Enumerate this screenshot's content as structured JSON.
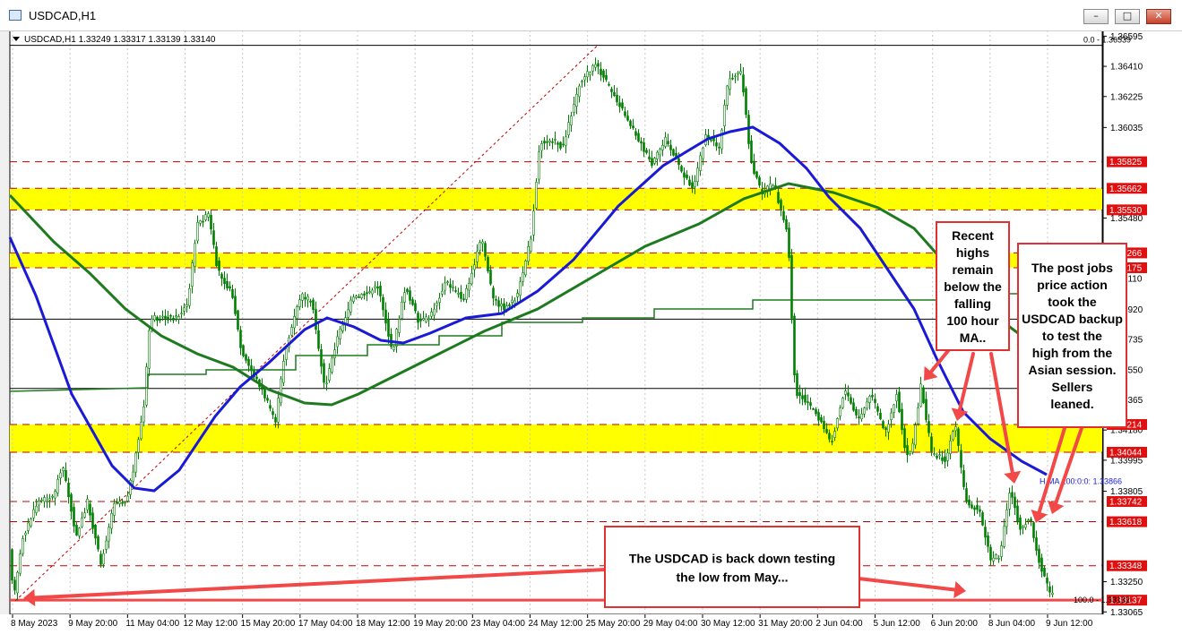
{
  "window": {
    "title": "USDCAD,H1",
    "controls": {
      "minimize": "–",
      "maximize": "□",
      "close": "✕"
    }
  },
  "colors": {
    "candle": "#008000",
    "ma100": "#1a1ad6",
    "ma200": "#1e7a1e",
    "ma_long": "#1e7a1e",
    "zone": "#ffff00",
    "dashed_level": "#c00000",
    "label_bg": "#e01010",
    "annotation_border": "#e03030",
    "arrow": "#f24848",
    "fib": "#c00000"
  },
  "chart_data": {
    "type": "candlestick",
    "symbol": "USDCAD",
    "timeframe": "H1",
    "header": "USDCAD,H1  1.33249 1.33317 1.33139 1.33140",
    "y_range": [
      1.3305,
      1.3663
    ],
    "price_axis_ticks": [
      1.36595,
      1.3641,
      1.36225,
      1.36035,
      1.3548,
      1.3511,
      1.3492,
      1.34735,
      1.3455,
      1.34365,
      1.3418,
      1.33995,
      1.33805,
      1.3325,
      1.33065
    ],
    "x_axis_ticks": [
      "8 May 2023",
      "9 May 20:00",
      "11 May 04:00",
      "12 May 12:00",
      "15 May 20:00",
      "17 May 04:00",
      "18 May 12:00",
      "19 May 20:00",
      "23 May 04:00",
      "24 May 12:00",
      "25 May 20:00",
      "29 May 04:00",
      "30 May 12:00",
      "31 May 20:00",
      "2 Jun 04:00",
      "5 Jun 12:00",
      "6 Jun 20:00",
      "8 Jun 04:00",
      "9 Jun 12:00"
    ],
    "levels": [
      {
        "price": 1.35825,
        "label": "1.35825"
      },
      {
        "price": 1.35662,
        "label": "1.35662"
      },
      {
        "price": 1.3553,
        "label": "1.35530"
      },
      {
        "price": 1.35266,
        "label": "1.35266"
      },
      {
        "price": 1.35175,
        "label": "1.35175"
      },
      {
        "price": 1.34214,
        "label": "1.34214"
      },
      {
        "price": 1.34044,
        "label": "1.34044"
      },
      {
        "price": 1.33742,
        "label": "1.33742"
      },
      {
        "price": 1.33618,
        "label": "1.33618"
      },
      {
        "price": 1.33348,
        "label": "1.33348"
      },
      {
        "price": 1.33137,
        "label": "1.33137"
      }
    ],
    "zones": [
      {
        "from": 1.3553,
        "to": 1.35662
      },
      {
        "from": 1.35175,
        "to": 1.35266
      },
      {
        "from": 1.34044,
        "to": 1.34214
      }
    ],
    "horizontal_lines": [
      1.36539,
      1.3486,
      1.34435
    ],
    "fib": {
      "top_label": "0.0 - 1.36539",
      "bottom_label": "100.0 - 1.33132",
      "low_price": 1.33132,
      "high_price": 1.36539
    },
    "ma_label": "H MA 100:0:0: 1.33866",
    "ma_label_price": 1.33866,
    "right_edge_marks": [
      "7",
      "8",
      "5",
      "6",
      "3"
    ],
    "close_price": 1.3314
  },
  "annotations": {
    "highs_note": "Recent highs remain below the falling 100 hour MA..",
    "jobs_note": "The post jobs price action took the USDCAD backup to test the high from the Asian session. Sellers leaned.",
    "low_note": "The USDCAD is back down testing the low from May..."
  }
}
